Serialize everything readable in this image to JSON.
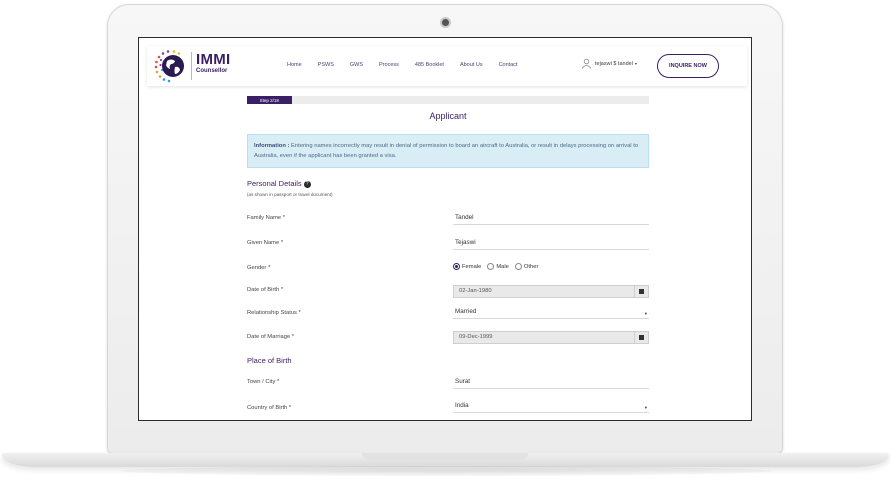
{
  "header": {
    "brand": "IMMI",
    "brand_sub": "Counsellor",
    "nav": [
      "Home",
      "PSWS",
      "GWS",
      "Process",
      "485 Booklet",
      "About Us",
      "Contact"
    ],
    "user": "tejaswi $ tandel",
    "inquire_label": "INQUIRE NOW"
  },
  "progress": {
    "label": "Step 2/18",
    "fraction": 0.111
  },
  "page_title": "Applicant",
  "info": {
    "bold": "Information :",
    "text": " Entering names incorrectly may result in denial of permission to board an aircraft to Australia, or result in delays processing on arrival to Australia, even if the applicant has been granted a visa."
  },
  "personal": {
    "heading": "Personal Details",
    "note": "(as shown in passport or travel document)",
    "family_name_label": "Family Name *",
    "family_name": "Tandel",
    "given_name_label": "Given Name *",
    "given_name": "Tejaswi",
    "gender_label": "Gender *",
    "gender_options": [
      "Female",
      "Male",
      "Other"
    ],
    "dob_label": "Date of Birth *",
    "dob": "02-Jan-1980",
    "relationship_label": "Relationship Status *",
    "relationship": "Married",
    "dom_label": "Date of Marriage *",
    "dom": "09-Dec-1999"
  },
  "birth": {
    "heading": "Place of Birth",
    "town_label": "Town / City *",
    "town": "Surat",
    "country_label": "Country of Birth *",
    "country": "India"
  },
  "colors": {
    "primary": "#3a1f66",
    "info_bg": "#d8edf6"
  }
}
